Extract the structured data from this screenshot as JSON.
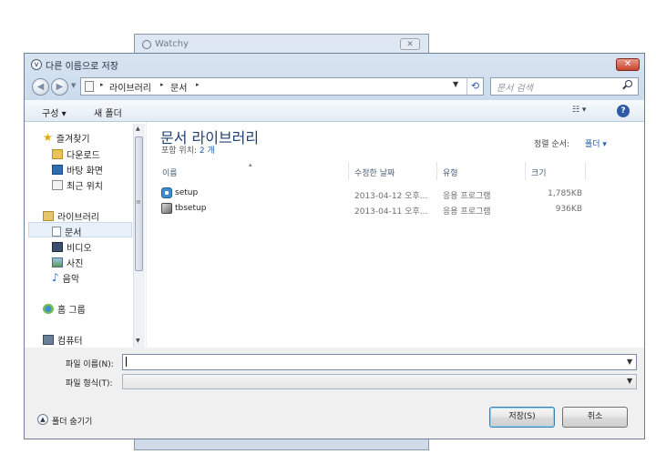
{
  "background_window": {
    "title": "Watchy",
    "close": "✕"
  },
  "dialog": {
    "title": "다른 이름으로 저장",
    "close": "✕"
  },
  "nav": {
    "back": "◀",
    "forward": "▶",
    "breadcrumbs": [
      "▸",
      "라이브러리",
      "▸",
      "문서",
      "▸"
    ],
    "dropdown": "▼",
    "refresh": "⟲",
    "search_placeholder": "문서 검색"
  },
  "toolbar": {
    "organize": "구성 ▾",
    "new_folder": "새 폴더",
    "view": "☷ ▾",
    "help": "?"
  },
  "sidebar": {
    "items": [
      {
        "label": "즐겨찾기",
        "icon": "star-icon"
      },
      {
        "label": "다운로드",
        "icon": "download-folder-icon"
      },
      {
        "label": "바탕 화면",
        "icon": "desktop-icon"
      },
      {
        "label": "최근 위치",
        "icon": "recent-places-icon"
      },
      {
        "label": "라이브러리",
        "icon": "library-icon"
      },
      {
        "label": "문서",
        "icon": "document-icon"
      },
      {
        "label": "비디오",
        "icon": "video-icon"
      },
      {
        "label": "사진",
        "icon": "picture-icon"
      },
      {
        "label": "음악",
        "icon": "music-icon"
      },
      {
        "label": "홈 그룹",
        "icon": "homegroup-icon"
      },
      {
        "label": "컴퓨터",
        "icon": "computer-icon"
      }
    ],
    "scroll_up": "▲",
    "scroll_grip": "≡",
    "scroll_down": "▼"
  },
  "content": {
    "title": "문서 라이브러리",
    "subtitle_prefix": "포함 위치:",
    "subtitle_count": "2 개",
    "arrange_label": "정렬 순서:",
    "arrange_value": "폴더 ▾",
    "sort_indicator": "▴",
    "columns": [
      "이름",
      "수정한 날짜",
      "유형",
      "크기"
    ],
    "rows": [
      {
        "name": "setup",
        "date": "2013-04-12 오후...",
        "type": "응용 프로그램",
        "size": "1,785KB",
        "icon": "setup-app-icon"
      },
      {
        "name": "tbsetup",
        "date": "2013-04-11 오후...",
        "type": "응용 프로그램",
        "size": "936KB",
        "icon": "installer-app-icon"
      }
    ]
  },
  "form": {
    "filename_label": "파일 이름(N):",
    "filename_value": "",
    "filetype_label": "파일 형식(T):",
    "filetype_value": "",
    "dropdown": "▼"
  },
  "footer": {
    "hide_folders": "폴더 숨기기",
    "hide_icon": "▲",
    "save_label": "저장(S)",
    "cancel_label": "취소"
  },
  "colors": {
    "accent": "#1f3f73",
    "link": "#1f5fb0",
    "close_red": "#c8432e",
    "selection": "#e8f0fa"
  }
}
